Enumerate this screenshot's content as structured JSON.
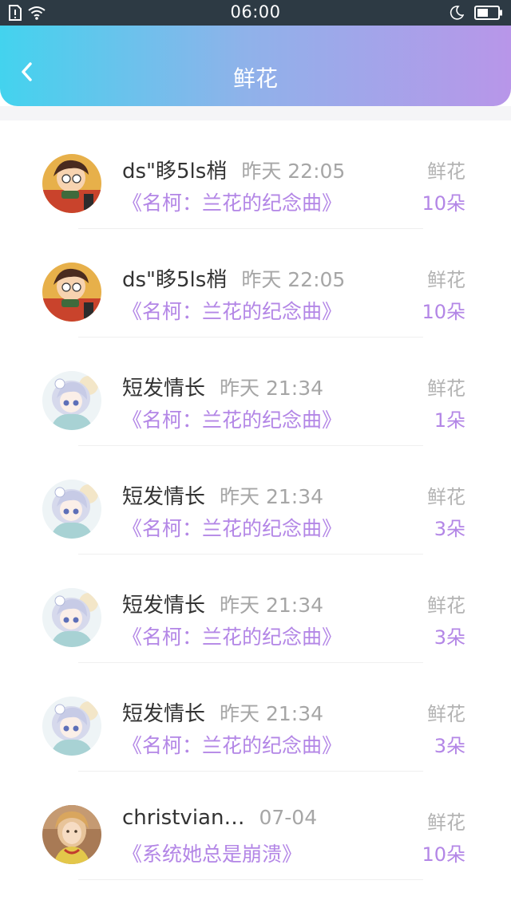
{
  "status_bar": {
    "time": "06:00",
    "icons": [
      "sim-alert-icon",
      "wifi-icon",
      "moon-icon",
      "battery-icon"
    ]
  },
  "header": {
    "title": "鲜花",
    "back_icon": "chevron-left-icon"
  },
  "colors": {
    "header_gradient": [
      "#43d3ee",
      "#8fb2ea",
      "#b896e9"
    ],
    "accent_purple": "#b386e6",
    "status_bar_bg": "#2d3a44"
  },
  "list": [
    {
      "name": "ds\"眵5ls梢",
      "time": "昨天 22:05",
      "song": "《名柯：兰花的纪念曲》",
      "gift": "鲜花",
      "count": "10朵",
      "avatar": "avatar-boy"
    },
    {
      "name": "ds\"眵5ls梢",
      "time": "昨天 22:05",
      "song": "《名柯：兰花的纪念曲》",
      "gift": "鲜花",
      "count": "10朵",
      "avatar": "avatar-boy"
    },
    {
      "name": "短发情长",
      "time": "昨天 21:34",
      "song": "《名柯：兰花的纪念曲》",
      "gift": "鲜花",
      "count": "1朵",
      "avatar": "avatar-anime-girl"
    },
    {
      "name": "短发情长",
      "time": "昨天 21:34",
      "song": "《名柯：兰花的纪念曲》",
      "gift": "鲜花",
      "count": "3朵",
      "avatar": "avatar-anime-girl"
    },
    {
      "name": "短发情长",
      "time": "昨天 21:34",
      "song": "《名柯：兰花的纪念曲》",
      "gift": "鲜花",
      "count": "3朵",
      "avatar": "avatar-anime-girl"
    },
    {
      "name": "短发情长",
      "time": "昨天 21:34",
      "song": "《名柯：兰花的纪念曲》",
      "gift": "鲜花",
      "count": "3朵",
      "avatar": "avatar-anime-girl"
    },
    {
      "name": "christvian…",
      "time": "07-04",
      "song": "《系统她总是崩溃》",
      "gift": "鲜花",
      "count": "10朵",
      "avatar": "avatar-photo-girl"
    }
  ]
}
